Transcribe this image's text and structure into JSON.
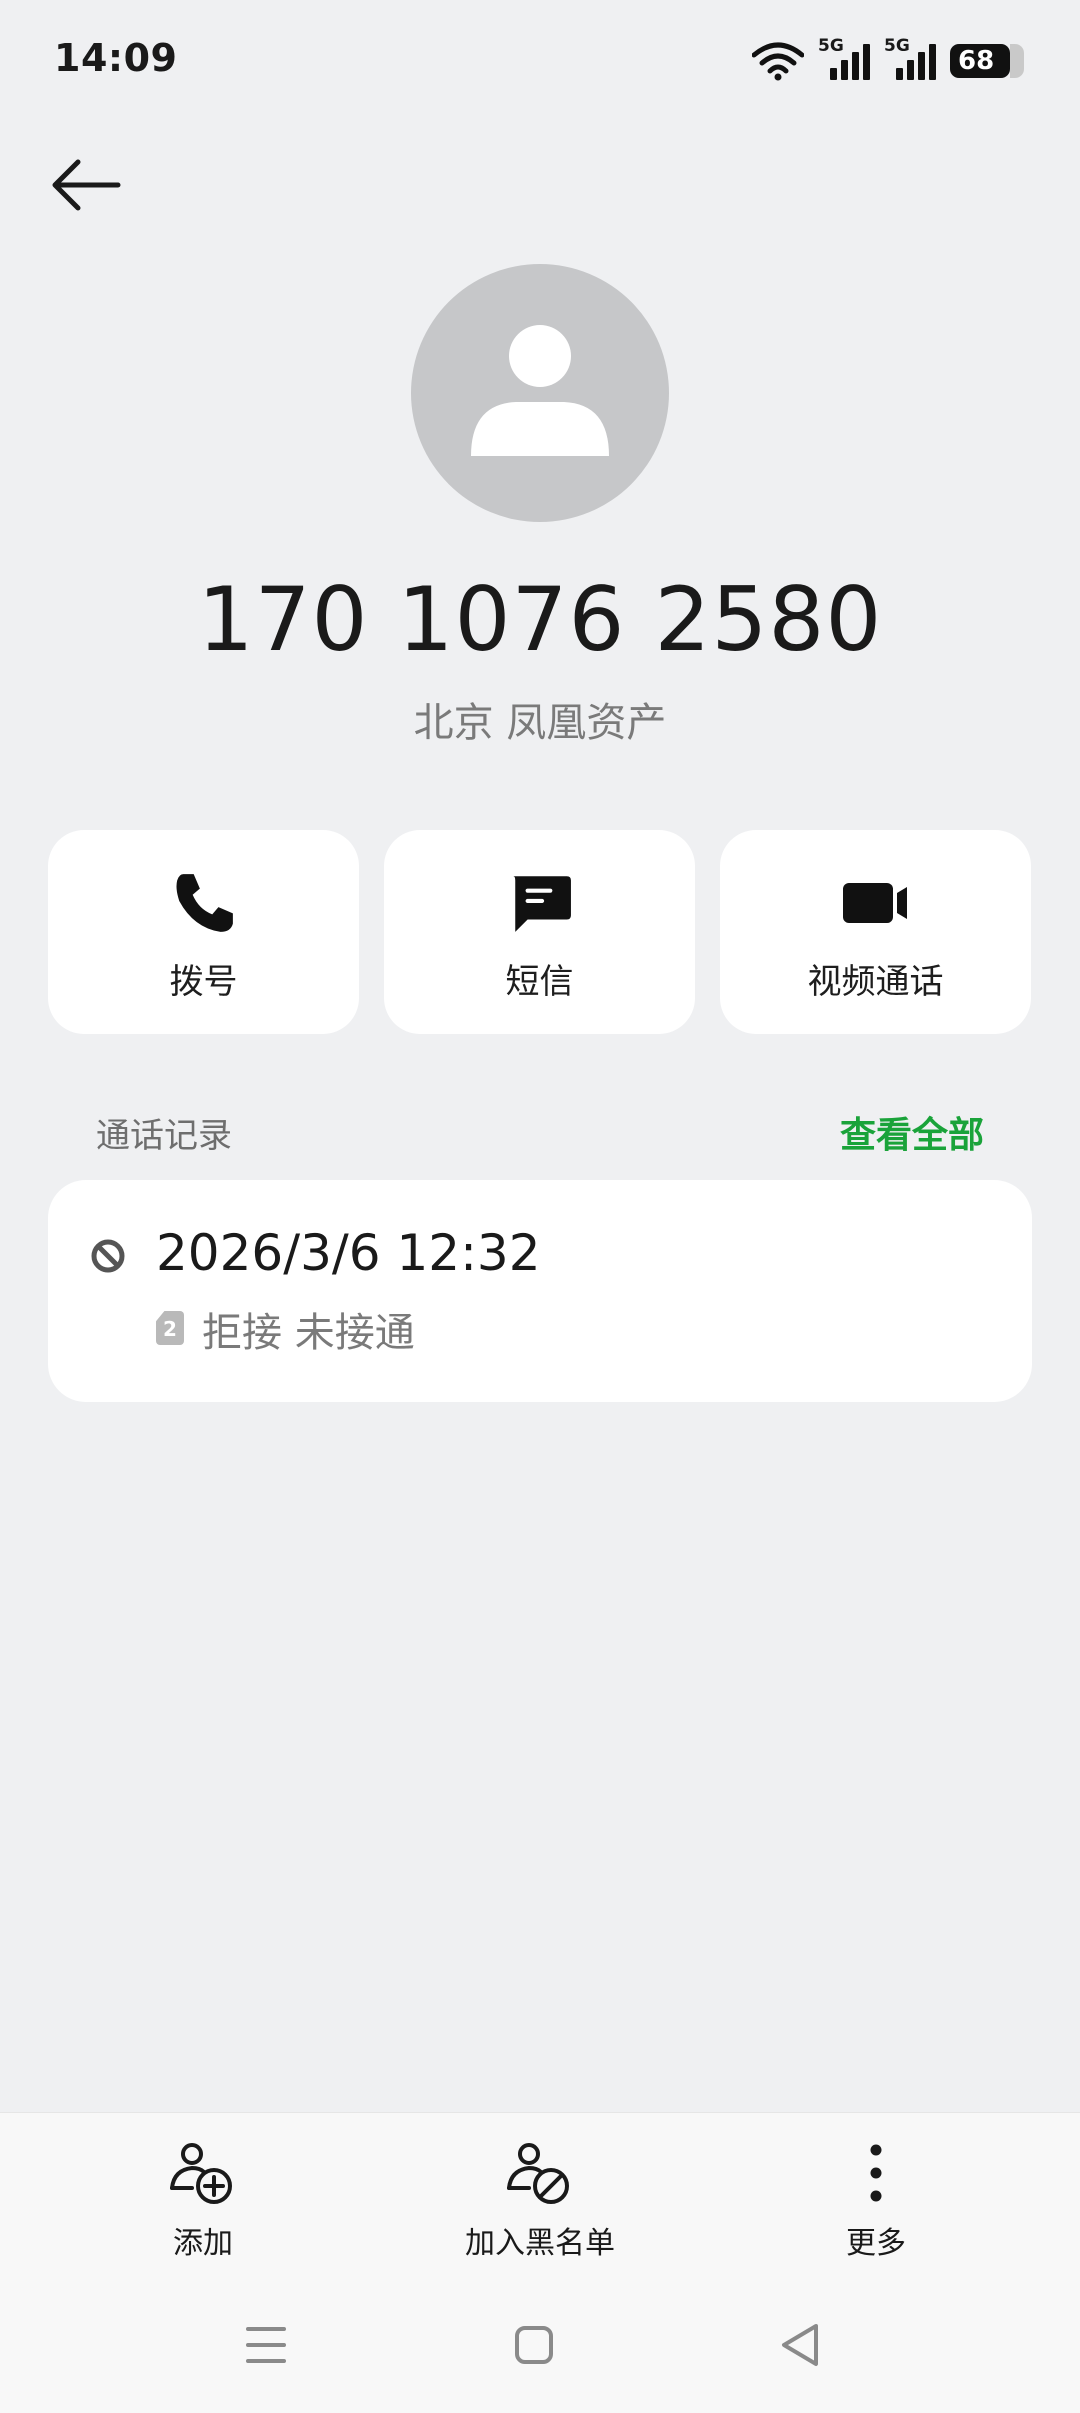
{
  "status_bar": {
    "time": "14:09",
    "network_1": "5G",
    "network_2": "5G",
    "battery": "68"
  },
  "contact": {
    "phone_number": "170 1076 2580",
    "location": "北京 凤凰资产"
  },
  "actions": [
    {
      "label": "拨号",
      "icon": "phone-icon"
    },
    {
      "label": "短信",
      "icon": "message-icon"
    },
    {
      "label": "视频通话",
      "icon": "video-icon"
    }
  ],
  "call_records": {
    "title": "通话记录",
    "view_all": "查看全部",
    "items": [
      {
        "datetime": "2026/3/6 12:32",
        "sim": "2",
        "status": "拒接 未接通",
        "icon": "blocked-icon"
      }
    ]
  },
  "bottom_bar": {
    "add_label": "添加",
    "blacklist_label": "加入黑名单",
    "more_label": "更多"
  },
  "colors": {
    "background": "#eff0f2",
    "accent_green": "#1aa33a",
    "card": "#ffffff",
    "avatar": "#c6c7c9"
  }
}
